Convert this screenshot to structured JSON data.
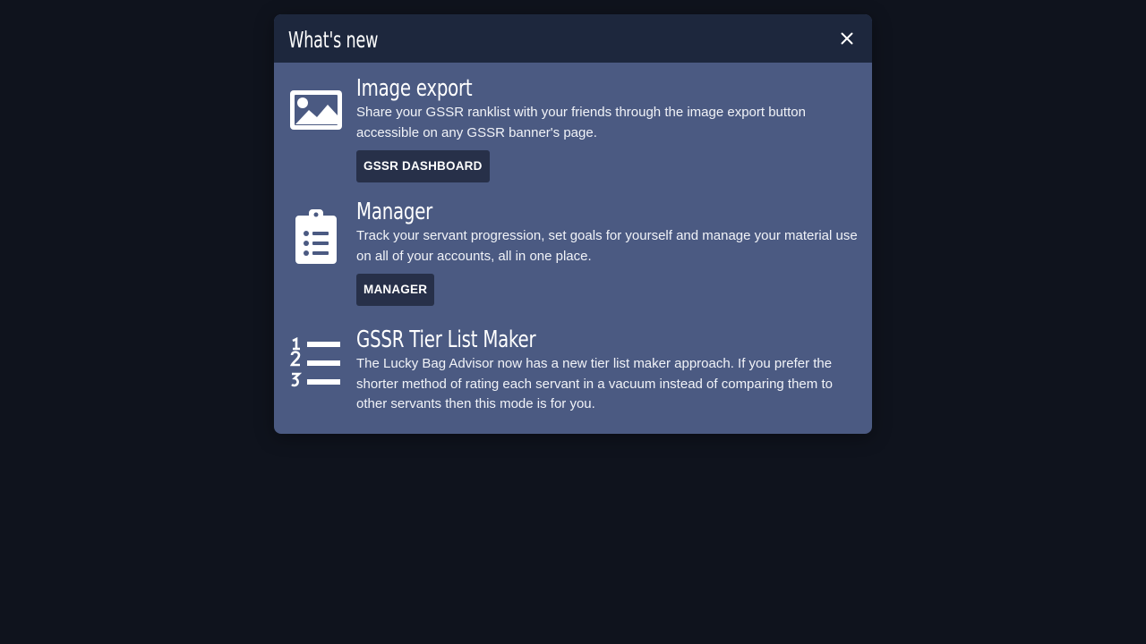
{
  "modal": {
    "title": "What's new",
    "close_icon": "close-icon"
  },
  "items": [
    {
      "icon": "image-icon",
      "title": "Image export",
      "description": "Share your GSSR ranklist with your friends through the image export button accessible on any GSSR banner's page.",
      "button_label": "GSSR DASHBOARD"
    },
    {
      "icon": "clipboard-list-icon",
      "title": "Manager",
      "description": "Track your servant progression, set goals for yourself and manage your material use on all of your accounts, all in one place.",
      "button_label": "MANAGER"
    },
    {
      "icon": "numbered-list-icon",
      "title": "GSSR Tier List Maker",
      "description": "The Lucky Bag Advisor now has a new tier list maker approach. If you prefer the shorter method of rating each servant in a vacuum instead of comparing them to other servants then this mode is for you."
    }
  ],
  "colors": {
    "page_background": "#0f131d",
    "header_background": "#1d273d",
    "body_background": "#4b5a82",
    "button_background": "#273049"
  }
}
